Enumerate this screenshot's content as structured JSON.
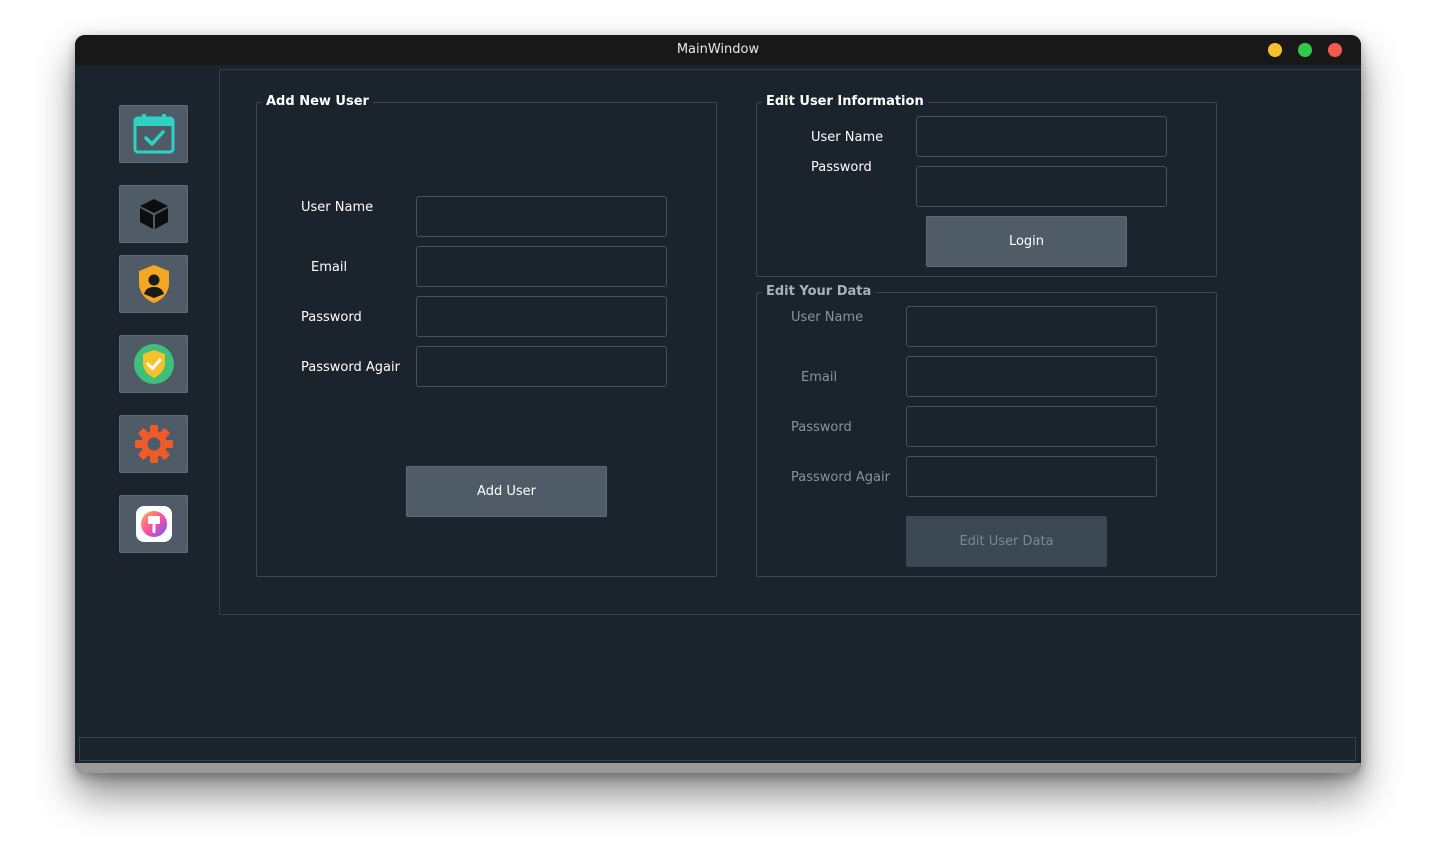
{
  "window": {
    "title": "MainWindow"
  },
  "colors": {
    "background": "#1b232c",
    "button": "#4f5b67",
    "accent_teal": "#2ed3c6",
    "accent_orange": "#f5a623",
    "accent_green": "#3fc07a",
    "accent_red": "#ef5a2a"
  },
  "sidebar": {
    "items": [
      {
        "icon": "calendar-check-icon"
      },
      {
        "icon": "cube-icon"
      },
      {
        "icon": "user-shield-icon"
      },
      {
        "icon": "check-shield-icon"
      },
      {
        "icon": "gear-icon"
      },
      {
        "icon": "paint-app-icon"
      }
    ]
  },
  "add_user": {
    "title": "Add New User",
    "username_label": "User Name",
    "email_label": "Email",
    "password_label": "Password",
    "password_again_label": "Password Agair",
    "button_label": "Add User"
  },
  "edit_info": {
    "title": "Edit User Information",
    "username_label": "User Name",
    "password_label": "Password",
    "login_label": "Login"
  },
  "edit_data": {
    "title": "Edit Your Data",
    "username_label": "User Name",
    "email_label": "Email",
    "password_label": "Password",
    "password_again_label": "Password Agair",
    "button_label": "Edit User Data"
  }
}
